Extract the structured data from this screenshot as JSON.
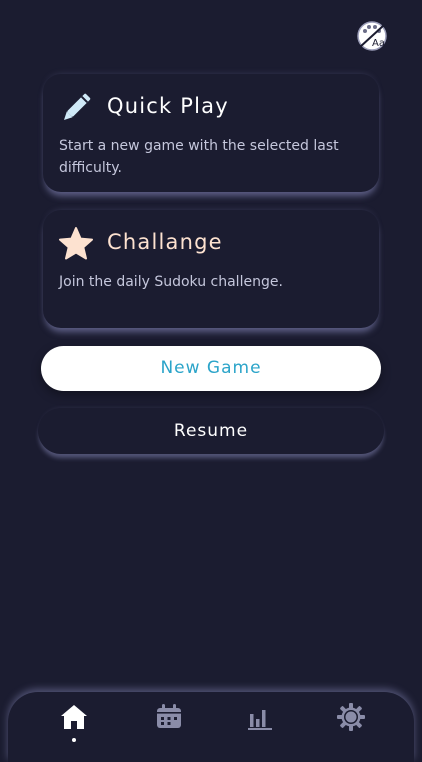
{
  "header": {
    "theme_icon": "palette-font-icon",
    "theme_label": "Aa"
  },
  "cards": {
    "quick_play": {
      "icon": "pencil-icon",
      "title": "Quick Play",
      "description": "Start a new game with the selected last difficulty."
    },
    "challenge": {
      "icon": "star-icon",
      "title": "Challange",
      "description": "Join the daily Sudoku challenge."
    }
  },
  "buttons": {
    "new_game": "New Game",
    "resume": "Resume"
  },
  "tabbar": {
    "items": [
      {
        "icon": "home-icon",
        "active": true
      },
      {
        "icon": "calendar-icon",
        "active": false
      },
      {
        "icon": "stats-icon",
        "active": false
      },
      {
        "icon": "gear-icon",
        "active": false
      }
    ]
  },
  "colors": {
    "background": "#1b1c30",
    "accent": "#2ba4c9",
    "star": "#fde2d0",
    "pencil": "#cfe9f7",
    "tab_inactive": "#8a8ca8"
  }
}
